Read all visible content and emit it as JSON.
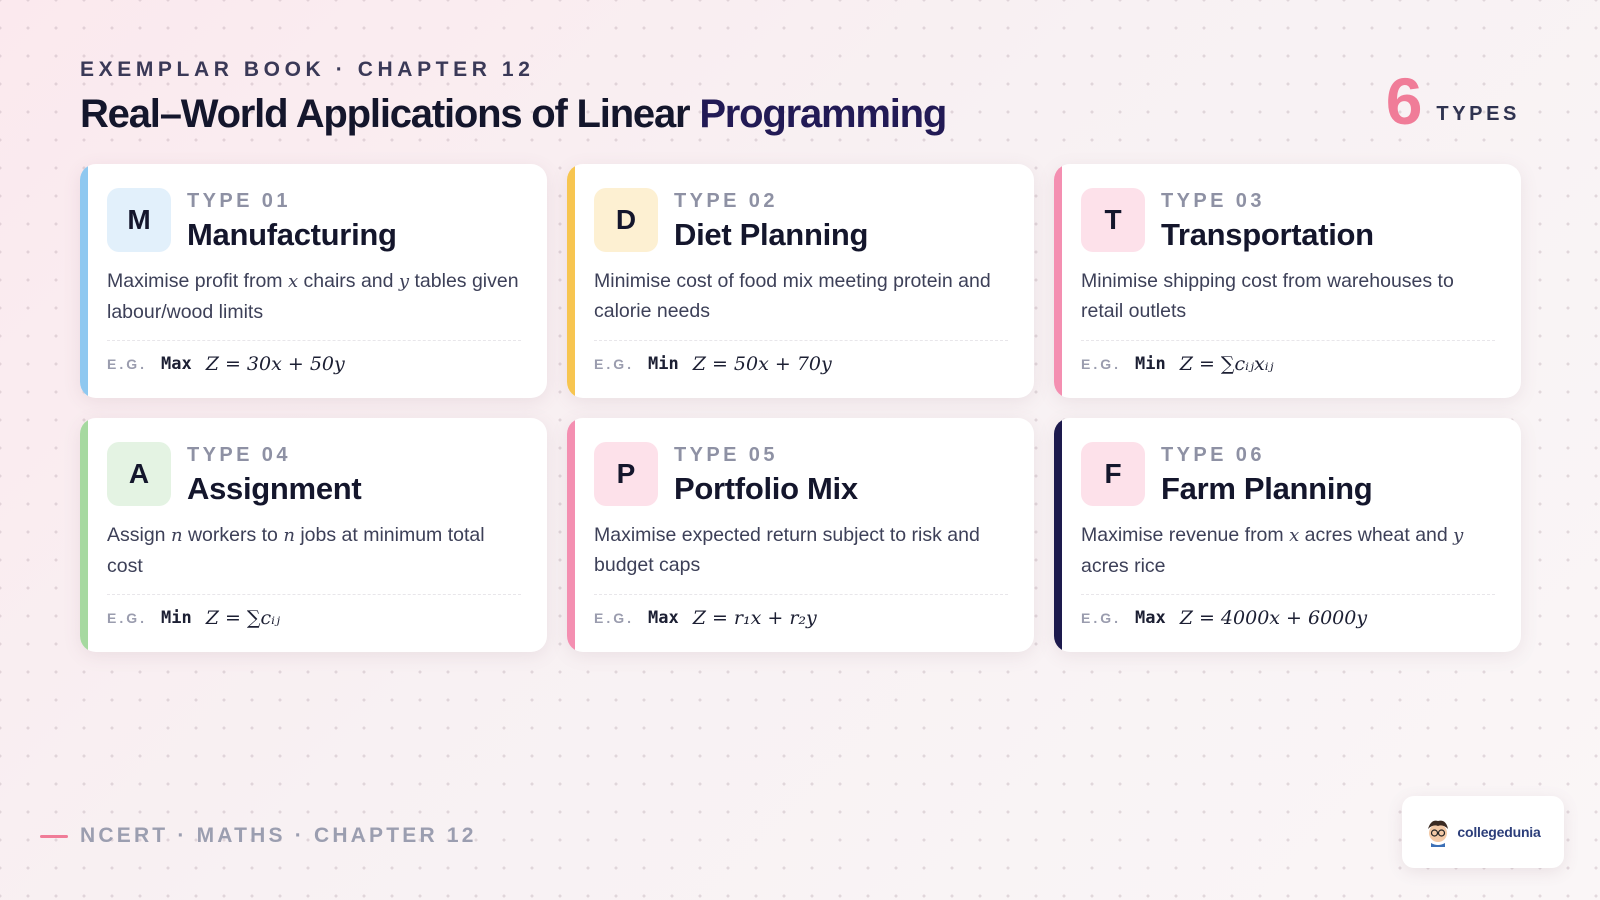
{
  "header": {
    "kicker": "EXEMPLAR BOOK · CHAPTER 12",
    "title_main": "Real–World Applications of Linear ",
    "title_accent": "Programming",
    "count_number": "6",
    "count_label": "TYPES"
  },
  "colors": {
    "accent_pink": "#f07c98",
    "blue": "#8fc8f0",
    "amber": "#f7c550",
    "pink": "#f48fb1",
    "green": "#a6d9a0",
    "navy": "#1d1a4d"
  },
  "cards": [
    {
      "letter": "M",
      "type_label": "TYPE 01",
      "name": "Manufacturing",
      "desc_1": "Maximise profit from ",
      "var_1": "x",
      "desc_2": " chairs and ",
      "var_2": "y",
      "desc_3": " tables given labour/wood limits",
      "eg_label": "E.G.",
      "eg_op": "Max",
      "eg_expr": "Z = 30x + 50y",
      "stripe_color": "#8fc8f0",
      "badge_bg": "#e2f0fb"
    },
    {
      "letter": "D",
      "type_label": "TYPE 02",
      "name": "Diet Planning",
      "desc_1": "Minimise cost of food mix meeting protein and calorie needs",
      "var_1": "",
      "desc_2": "",
      "var_2": "",
      "desc_3": "",
      "eg_label": "E.G.",
      "eg_op": "Min",
      "eg_expr": "Z = 50x + 70y",
      "stripe_color": "#f7c550",
      "badge_bg": "#fdf0d2"
    },
    {
      "letter": "T",
      "type_label": "TYPE 03",
      "name": "Transportation",
      "desc_1": "Minimise shipping cost from warehouses to retail outlets",
      "var_1": "",
      "desc_2": "",
      "var_2": "",
      "desc_3": "",
      "eg_label": "E.G.",
      "eg_op": "Min",
      "eg_expr": "Z = ∑cᵢⱼxᵢⱼ",
      "stripe_color": "#f48fb1",
      "badge_bg": "#fde1ea"
    },
    {
      "letter": "A",
      "type_label": "TYPE 04",
      "name": "Assignment",
      "desc_1": "Assign ",
      "var_1": "n",
      "desc_2": " workers to ",
      "var_2": "n",
      "desc_3": " jobs at minimum total cost",
      "eg_label": "E.G.",
      "eg_op": "Min",
      "eg_expr": "Z = ∑cᵢⱼ",
      "stripe_color": "#a6d9a0",
      "badge_bg": "#e4f3e3"
    },
    {
      "letter": "P",
      "type_label": "TYPE 05",
      "name": "Portfolio Mix",
      "desc_1": "Maximise expected return subject to risk and budget caps",
      "var_1": "",
      "desc_2": "",
      "var_2": "",
      "desc_3": "",
      "eg_label": "E.G.",
      "eg_op": "Max",
      "eg_expr": "Z = r₁x + r₂y",
      "stripe_color": "#f48fb1",
      "badge_bg": "#fde1ea"
    },
    {
      "letter": "F",
      "type_label": "TYPE 06",
      "name": "Farm Planning",
      "desc_1": "Maximise revenue from ",
      "var_1": "x",
      "desc_2": " acres wheat and ",
      "var_2": "y",
      "desc_3": " acres rice",
      "eg_label": "E.G.",
      "eg_op": "Max",
      "eg_expr": "Z = 4000x + 6000y",
      "stripe_color": "#1d1a4d",
      "badge_bg": "#fde1ea"
    }
  ],
  "footer": {
    "text": "NCERT · MATHS · CHAPTER 12"
  },
  "logo": {
    "text": "collegedunia"
  }
}
